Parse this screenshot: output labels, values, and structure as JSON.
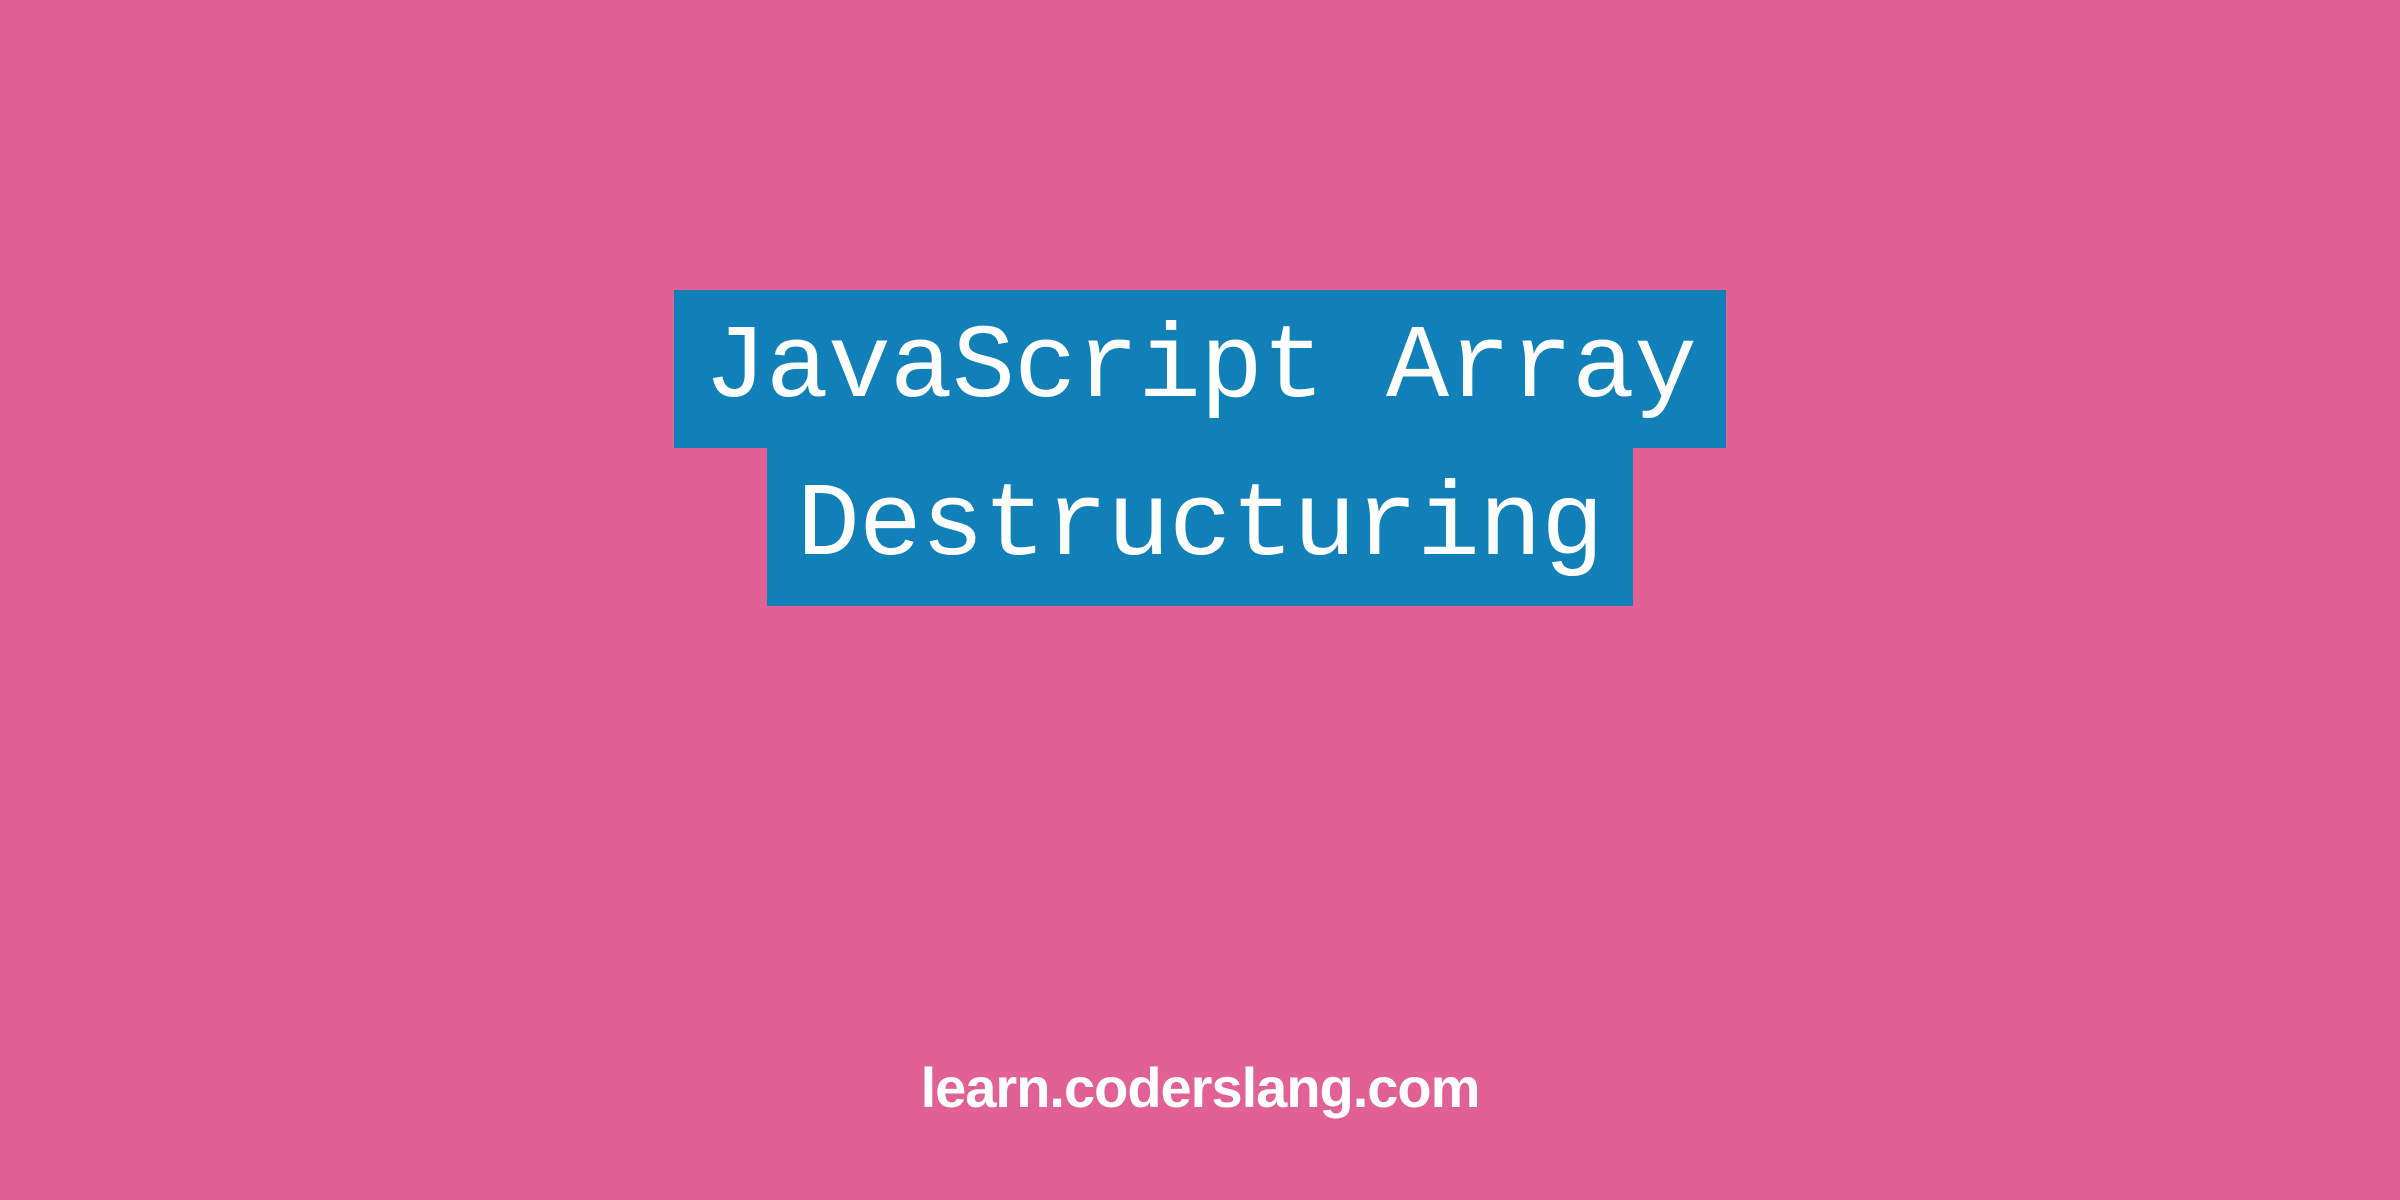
{
  "title": {
    "line1": "JavaScript Array",
    "line2": "Destructuring"
  },
  "footer": {
    "text": "learn.coderslang.com"
  },
  "colors": {
    "background": "#e16194",
    "titleBackground": "#1180b8",
    "titleText": "#ffffff",
    "footerText": "#ffffff"
  }
}
